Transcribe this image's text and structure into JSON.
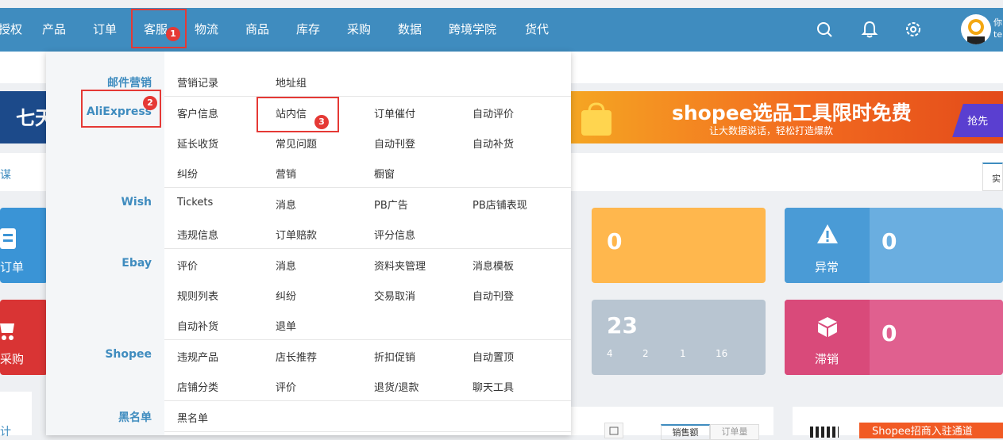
{
  "nav": {
    "items": [
      "授权",
      "产品",
      "订单",
      "客服",
      "物流",
      "商品",
      "库存",
      "采购",
      "数据",
      "跨境学院",
      "货代"
    ]
  },
  "badges": {
    "b1": "1",
    "b2": "2",
    "b3": "3"
  },
  "user": {
    "line1": "你",
    "line2": "te"
  },
  "banner_left": {
    "text": "七天"
  },
  "banner_right": {
    "title": "shopee选品工具限时免费",
    "subtitle": "让大数据说话，轻松打造爆款",
    "cta": "抢先"
  },
  "side_tab": {
    "label": "谋"
  },
  "right_tab": {
    "label": "实"
  },
  "cards": {
    "order_label": "订单",
    "purchase_label": "采购",
    "orange_value": "0",
    "abnormal_value": "0",
    "abnormal_label": "异常",
    "grey_value": "23",
    "grey_small": [
      "4",
      "2",
      "1",
      "16"
    ],
    "slow_value": "0",
    "slow_label": "滞销"
  },
  "bottom": {
    "left_label": "计",
    "tab1": "销售额",
    "tab2": "订单量",
    "shopee_tag": "Shopee招商入驻通道"
  },
  "menu": {
    "cat_mail": "邮件营销",
    "cat_ali": "AliExpress",
    "cat_wish": "Wish",
    "cat_ebay": "Ebay",
    "cat_shopee": "Shopee",
    "cat_black": "黑名单",
    "mail": [
      "营销记录",
      "地址组"
    ],
    "ali_r1": [
      "客户信息",
      "站内信",
      "订单催付",
      "自动评价"
    ],
    "ali_r2": [
      "延长收货",
      "常见问题",
      "自动刊登",
      "自动补货"
    ],
    "ali_r3": [
      "纠纷",
      "营销",
      "橱窗"
    ],
    "wish_r1": [
      "Tickets",
      "消息",
      "PB广告",
      "PB店铺表现"
    ],
    "wish_r2": [
      "违规信息",
      "订单赔款",
      "评分信息"
    ],
    "ebay_r1": [
      "评价",
      "消息",
      "资料夹管理",
      "消息模板"
    ],
    "ebay_r2": [
      "规则列表",
      "纠纷",
      "交易取消",
      "自动刊登"
    ],
    "ebay_r3": [
      "自动补货",
      "退单"
    ],
    "shopee_r1": [
      "违规产品",
      "店长推荐",
      "折扣促销",
      "自动置顶"
    ],
    "shopee_r2": [
      "店铺分类",
      "评价",
      "退货/退款",
      "聊天工具"
    ],
    "black": [
      "黑名单"
    ]
  },
  "colors": {
    "nav": "#3f8cbf",
    "blue_card": "#3a94d6",
    "red_card": "#d93434",
    "orange_card": "#ffb74d",
    "lightblue_card": "#6aaee0",
    "grey_card": "#a9b8c6",
    "pink_card": "#d94a7a",
    "highlight": "#e53935"
  }
}
